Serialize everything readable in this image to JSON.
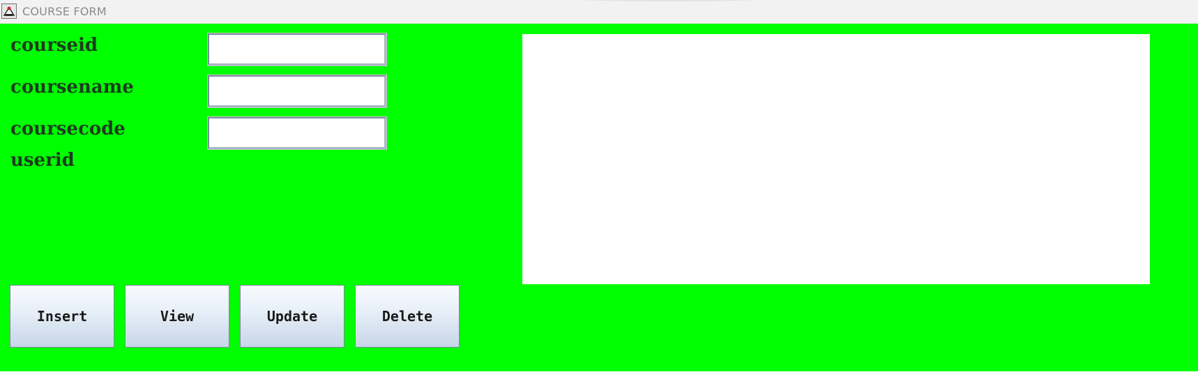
{
  "window": {
    "title": "COURSE FORM",
    "icon": "java-app-icon",
    "background_color": "#00ff00"
  },
  "form": {
    "fields": [
      {
        "label": "courseid",
        "value": "",
        "placeholder": ""
      },
      {
        "label": "coursename",
        "value": "",
        "placeholder": ""
      },
      {
        "label": "coursecode",
        "value": "",
        "placeholder": ""
      },
      {
        "label": "userid"
      }
    ]
  },
  "output": {
    "text": ""
  },
  "buttons": {
    "insert": "Insert",
    "view": "View",
    "update": "Update",
    "delete": "Delete"
  }
}
